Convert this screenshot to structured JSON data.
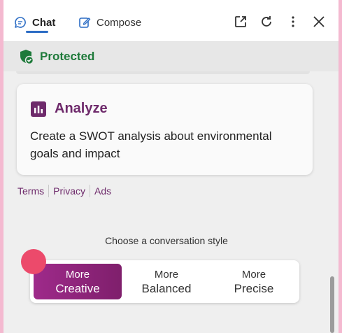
{
  "topbar": {
    "tabs": [
      {
        "label": "Chat",
        "icon": "chat-icon",
        "active": true
      },
      {
        "label": "Compose",
        "icon": "compose-icon",
        "active": false
      }
    ],
    "actions": [
      "open-new-window-icon",
      "refresh-icon",
      "more-options-icon",
      "close-icon"
    ]
  },
  "status": {
    "label": "Protected",
    "icon": "shield-check-icon"
  },
  "card": {
    "title": "Analyze",
    "icon": "chart-icon",
    "body": "Create a SWOT analysis about environmental goals and impact"
  },
  "links": {
    "terms": "Terms",
    "privacy": "Privacy",
    "ads": "Ads"
  },
  "conversation_style": {
    "heading": "Choose a conversation style",
    "options": [
      {
        "line1": "More",
        "line2": "Creative",
        "selected": true
      },
      {
        "line1": "More",
        "line2": "Balanced",
        "selected": false
      },
      {
        "line1": "More",
        "line2": "Precise",
        "selected": false
      }
    ]
  },
  "colors": {
    "accent": "#6e2a6b",
    "protected": "#1e7a3a",
    "creative_gradient_start": "#9e2a8a",
    "creative_gradient_end": "#7f1f6c",
    "indicator_dot": "#ec4a6b",
    "background": "#f4b9d0"
  }
}
